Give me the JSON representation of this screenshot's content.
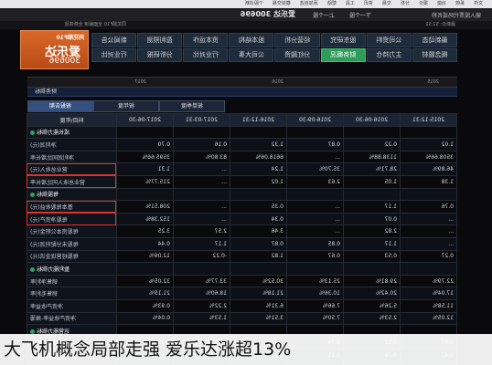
{
  "topbar": {
    "items": [
      "文件",
      "系统",
      "功能",
      "报价",
      "分析",
      "交易",
      "资讯",
      "工具",
      "帮助",
      "添加自选",
      "模拟交易",
      "个股诊断"
    ]
  },
  "titlebar": {
    "title": "爱乐达 300696",
    "prev": "上一个股",
    "next": "下一个股",
    "search_hint": "输入股票代码或名称"
  },
  "subnav": {
    "left": "同花顺F10 全面解读 全新体验",
    "right": "最新价: 52.51"
  },
  "logo": {
    "brand": "同花顺F10",
    "name": "爱乐达",
    "code": "300696"
  },
  "nav": {
    "row1": [
      "最新动态",
      "公司资料",
      "股东研究",
      "经营分析",
      "股本结构",
      "资本运作",
      "盈利预测",
      "新闻公告"
    ],
    "row2": [
      "概念题材",
      "主力持仓",
      "财务概况",
      "分红融资",
      "公司大事",
      "行业对比",
      "分析研报",
      "行业对比"
    ],
    "active": "财务概况"
  },
  "section": {
    "years": [
      "2017",
      "2016",
      "2015"
    ],
    "header_right": "财务指标"
  },
  "tabs": {
    "items": [
      "按报告期",
      "按年度",
      "按单季度"
    ],
    "selected": "按报告期"
  },
  "table": {
    "columns": [
      "科目\\年度",
      "2017-06-30",
      "2017-03-31",
      "2016-12-31",
      "2016-09-30",
      "2016-06-30",
      "2015-12-31",
      "2014-12-31"
    ],
    "rows": [
      {
        "label": "成长能力指标",
        "values": [
          "",
          "",
          "",
          "",
          "",
          "",
          ""
        ],
        "group": true,
        "hl": false
      },
      {
        "label": "净利润(元)",
        "values": [
          "0.70",
          "0.16",
          "1.32",
          "0.87",
          "0.22",
          "1.02",
          "0.34"
        ],
        "group": false,
        "hl": false
      },
      {
        "label": "净利润同比增长率",
        "values": [
          "3595.66%",
          "83.80%",
          "6618.06%",
          "...",
          "1138.88%",
          "3508.66%",
          "3383.31%"
        ],
        "group": false,
        "hl": false
      },
      {
        "label": "营业总收入(元)",
        "values": [
          "1.31",
          "...",
          "1.24",
          "35.70%",
          "28.71%",
          "46.89%",
          "60.29%"
        ],
        "group": false,
        "hl": true
      },
      {
        "label": "营业总收入同比增长率",
        "values": [
          "215.77%",
          "...",
          "1.02",
          "2.63",
          "1.05",
          "1.38",
          "1.16"
        ],
        "group": false,
        "hl": true
      },
      {
        "label": "每股指标",
        "values": [
          "",
          "",
          "",
          "",
          "",
          "",
          ""
        ],
        "group": true,
        "hl": false
      },
      {
        "label": "基本每股收益(元)",
        "values": [
          "208.51%",
          "...",
          "0.35",
          "...",
          "1.17",
          "0.76",
          "1.93"
        ],
        "group": false,
        "hl": true
      },
      {
        "label": "每股净资产(元)",
        "values": [
          "152.38%",
          "...",
          "0.34",
          "...",
          "0.07",
          "...",
          "0.57"
        ],
        "group": false,
        "hl": true
      },
      {
        "label": "每股资本公积金(元)",
        "values": [
          "3.25",
          "2.57",
          "3.46",
          "...",
          "2.82",
          "...",
          "..."
        ],
        "group": false,
        "hl": false
      },
      {
        "label": "每股未分配利润(元)",
        "values": [
          "0.44",
          "1.17",
          "0.87",
          "0.85",
          "1.17",
          "...",
          "..."
        ],
        "group": false,
        "hl": false
      },
      {
        "label": "每股经营现金流(元)",
        "values": [
          "12.06%",
          "-0.22",
          "1.82",
          "0.67",
          "0.53",
          "0.27",
          "0.31"
        ],
        "group": false,
        "hl": false
      },
      {
        "label": "盈利能力指标",
        "values": [
          "",
          "",
          "",
          "",
          "",
          "",
          ""
        ],
        "group": true,
        "hl": false
      },
      {
        "label": "销售净利率",
        "values": [
          "32.05%",
          "33.77%",
          "30.52%",
          "25.13%",
          "29.81%",
          "22.79%",
          "22.19%"
        ],
        "group": false,
        "hl": false
      },
      {
        "label": "销售毛利率",
        "values": [
          "21.15%",
          "18.60%",
          "21.18%",
          "10.36%",
          "20.42%",
          "17.04%",
          "16.81%"
        ],
        "group": false,
        "hl": false
      },
      {
        "label": "净资产收益率",
        "values": [
          "0.93%",
          "2.22%",
          "6.31%",
          "7.66%",
          "5.26%",
          "11.58%",
          "13.38%"
        ],
        "group": false,
        "hl": false
      },
      {
        "label": "净资产收益率-摊薄",
        "values": [
          "0.04%",
          "1.53%",
          "3.51%",
          "7.50%",
          "2.53%",
          "12.05%",
          "1.33%"
        ],
        "group": false,
        "hl": false
      },
      {
        "label": "运营能力指标",
        "values": [
          "",
          "",
          "",
          "",
          "",
          "",
          ""
        ],
        "group": true,
        "hl": false
      },
      {
        "label": "营业周期(天)",
        "values": [
          "0.56",
          "0.27",
          "0.61",
          "0.74",
          "0.52",
          "0.47",
          "0.82"
        ],
        "group": false,
        "hl": false
      },
      {
        "label": "存货周转率(次)",
        "values": [
          "0.57",
          "0.36",
          "0.77",
          "1.11",
          "0.74",
          "0.42",
          "1.15"
        ],
        "group": false,
        "hl": false
      },
      {
        "label": "应收账款周转天数(天)",
        "values": [
          "0.38",
          "0.21",
          "0.32",
          "0.63",
          "0.77",
          "0.47",
          "1.13"
        ],
        "group": false,
        "hl": false
      }
    ]
  },
  "caption": {
    "text": "大飞机概念局部走强 爱乐达涨超13%"
  },
  "colors": {
    "accent": "#d9682a",
    "active_nav": "#2e9c5b",
    "highlight": "#e0322d",
    "bg": "#0a0a0c"
  }
}
